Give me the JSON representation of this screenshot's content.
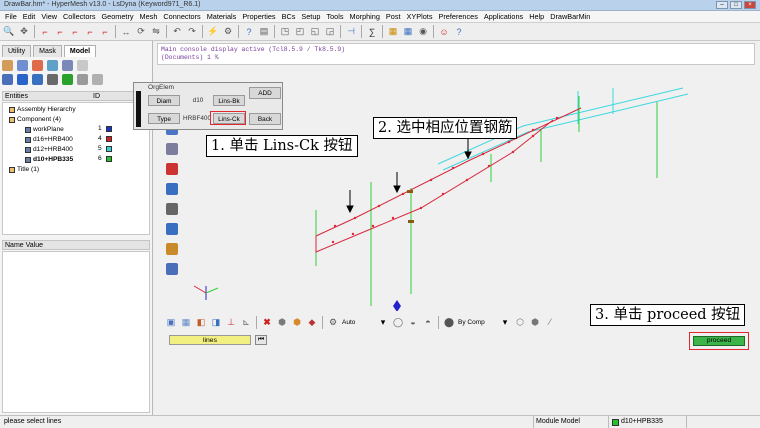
{
  "window": {
    "title": "DrawBar.hm* - HyperMesh v13.0 - LsDyna (Keyword971_R6.1)"
  },
  "menu": [
    "File",
    "Edit",
    "View",
    "Collectors",
    "Geometry",
    "Mesh",
    "Connectors",
    "Materials",
    "Properties",
    "BCs",
    "Setup",
    "Tools",
    "Morphing",
    "Post",
    "XYPlots",
    "Preferences",
    "Applications",
    "Help",
    "DrawBarMin"
  ],
  "left_panel": {
    "tabs": [
      "Utility",
      "Mask",
      "Model"
    ],
    "active_tab": "Model",
    "entities_header": "Entities",
    "id_header": "ID",
    "tree": [
      {
        "label": "Assembly Hierarchy",
        "id": "",
        "color": ""
      },
      {
        "label": "Component (4)",
        "id": "",
        "color": ""
      },
      {
        "label": "workPlane",
        "id": "1",
        "color": "#1a33c8"
      },
      {
        "label": "d16+HRB400",
        "id": "4",
        "color": "#d21f1f"
      },
      {
        "label": "d12+HRB400",
        "id": "5",
        "color": "#36d0d6"
      },
      {
        "label": "d10+HPB335",
        "id": "6",
        "color": "#22c22a"
      },
      {
        "label": "Title (1)",
        "id": "",
        "color": ""
      }
    ],
    "name_value_header": "Name Value"
  },
  "console": {
    "line1": "Main console display active (Tcl8.5.9 / Tk8.5.9)",
    "line2": "(Documents) 1 %"
  },
  "orig_panel": {
    "title": "OrgElem",
    "diam_label": "Diam",
    "diam_value": "d10",
    "lins_bk_label": "Lins-Bk",
    "add_label": "ADD",
    "type_label": "Type",
    "type_value": "HRBF400",
    "lins_ck_label": "Lins-Ck",
    "back_label": "Back"
  },
  "callouts": {
    "step1": "1. 单击 Lins-Ck 按钮",
    "step2": "2. 选中相应位置钢筋",
    "step3": "3. 单击 proceed 按钮"
  },
  "bottom_toolbar": {
    "auto_label": "Auto",
    "bycomp_label": "By Comp"
  },
  "selector": {
    "lines_label": "lines",
    "back_glyph": "⏮"
  },
  "proceed": {
    "label": "proceed"
  },
  "status": {
    "prompt": "please select lines",
    "module": "Module Model",
    "component": "d10+HPB335"
  },
  "colors": {
    "accent_red": "#e0282e",
    "rebar_red": "#d8283a",
    "rebar_green": "#2ed13a",
    "rebar_cyan": "#38d8e0",
    "proceed_green": "#3bb54a"
  }
}
